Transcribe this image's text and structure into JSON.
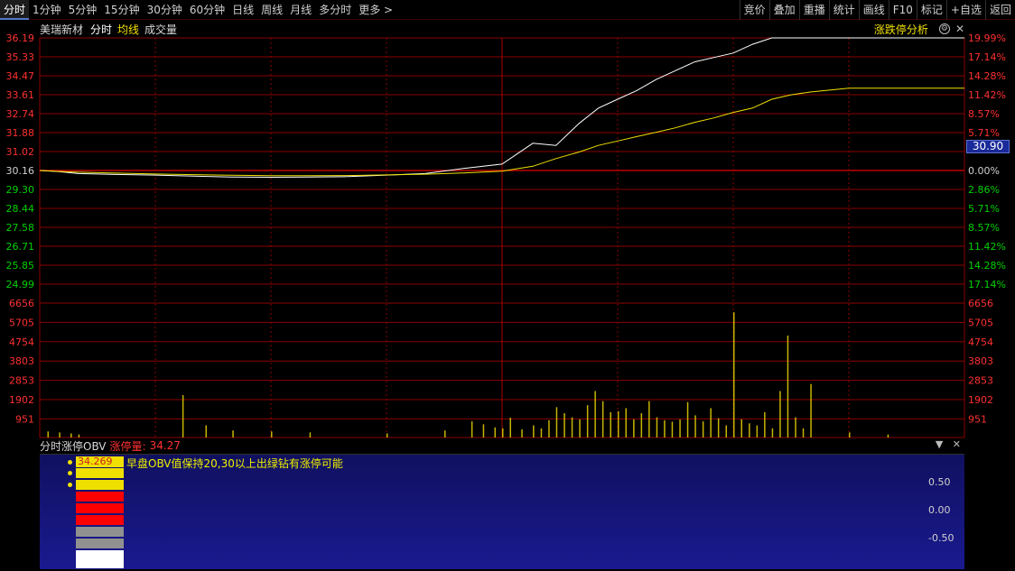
{
  "toolbar": {
    "left_items": [
      "分时",
      "1分钟",
      "5分钟",
      "15分钟",
      "30分钟",
      "60分钟",
      "日线",
      "周线",
      "月线",
      "多分时",
      "更多"
    ],
    "right_items": [
      "竞价",
      "叠加",
      "重播",
      "统计",
      "画线",
      "F10",
      "标记",
      "+自选",
      "返回"
    ]
  },
  "header": {
    "stock_name": "美瑞新材",
    "mode": "分时",
    "avg_label": "均线",
    "vol_label": "成交量",
    "analysis": "涨跌停分析"
  },
  "price_tag": "30.90",
  "indicator": {
    "name": "分时涨停OBV",
    "label": "涨停量:",
    "value": "34.27",
    "box_value": "34.269",
    "text": "早盘OBV值保持20,30以上出绿钻有涨停可能",
    "y_labels": [
      "0.50",
      "0.00",
      "-0.50"
    ]
  },
  "colors": {
    "grid": "#8b0000",
    "price_line": "#ffffff",
    "avg_line": "#f0e000",
    "volume": "#c8b400",
    "up": "#ff3030",
    "down": "#00d000",
    "diamond": "#40ff40"
  },
  "chart_data": [
    {
      "type": "line",
      "title": "",
      "y_labels_left": [
        "36.19",
        "35.33",
        "34.47",
        "33.61",
        "32.74",
        "31.88",
        "31.02",
        "30.16",
        "29.30",
        "28.44",
        "27.58",
        "26.71",
        "25.85",
        "24.99"
      ],
      "y_labels_right": [
        "19.99%",
        "17.14%",
        "14.28%",
        "11.42%",
        "8.57%",
        "5.71%",
        "",
        "0.00%",
        "2.86%",
        "5.71%",
        "8.57%",
        "11.42%",
        "14.28%",
        "17.14%"
      ],
      "ylim": [
        24.99,
        36.19
      ],
      "reference": 30.16,
      "x": [
        0,
        5,
        10,
        20,
        30,
        40,
        50,
        60,
        70,
        80,
        90,
        100,
        110,
        120,
        128,
        134,
        140,
        145,
        150,
        155,
        160,
        165,
        170,
        175,
        180,
        185,
        190,
        195,
        200,
        210,
        220,
        230,
        240
      ],
      "series": [
        {
          "values": [
            30.16,
            30.11,
            30.02,
            29.98,
            29.95,
            29.9,
            29.86,
            29.85,
            29.86,
            29.88,
            29.95,
            30.02,
            30.25,
            30.45,
            31.4,
            31.3,
            32.3,
            33.0,
            33.4,
            33.8,
            34.3,
            34.7,
            35.1,
            35.3,
            35.5,
            35.9,
            36.19,
            36.19,
            36.19,
            36.19,
            36.19,
            36.19,
            36.19
          ]
        },
        {
          "values": [
            30.16,
            30.12,
            30.08,
            30.04,
            30.0,
            29.97,
            29.94,
            29.92,
            29.92,
            29.93,
            29.96,
            29.99,
            30.05,
            30.13,
            30.35,
            30.7,
            31.0,
            31.3,
            31.5,
            31.7,
            31.9,
            32.1,
            32.35,
            32.55,
            32.8,
            33.0,
            33.4,
            33.6,
            33.73,
            33.9,
            33.9,
            33.9,
            33.9
          ]
        }
      ]
    },
    {
      "type": "bar",
      "title": "",
      "y_labels_left": [
        "6656",
        "5705",
        "4754",
        "3803",
        "2853",
        "1902",
        "951"
      ],
      "y_labels_right": [
        "6656",
        "5705",
        "4754",
        "3803",
        "2853",
        "1902",
        "951"
      ],
      "ylim": [
        0,
        6656
      ],
      "x": [
        2,
        5,
        8,
        10,
        37,
        43,
        50,
        60,
        70,
        90,
        105,
        112,
        115,
        118,
        120,
        122,
        125,
        128,
        130,
        132,
        134,
        136,
        138,
        140,
        142,
        144,
        146,
        148,
        150,
        152,
        154,
        156,
        158,
        160,
        162,
        164,
        166,
        168,
        170,
        172,
        174,
        176,
        178,
        180,
        182,
        184,
        186,
        188,
        190,
        192,
        194,
        196,
        198,
        200,
        210,
        220
      ],
      "values": [
        300,
        250,
        200,
        150,
        2100,
        600,
        350,
        300,
        250,
        200,
        350,
        800,
        650,
        500,
        450,
        980,
        400,
        600,
        450,
        850,
        1500,
        1200,
        1000,
        900,
        1600,
        2300,
        1800,
        1250,
        1300,
        1450,
        900,
        1200,
        1800,
        1000,
        850,
        780,
        900,
        1750,
        1100,
        800,
        1450,
        950,
        600,
        6200,
        900,
        700,
        600,
        1250,
        450,
        2300,
        5050,
        1000,
        450,
        2650,
        250,
        150
      ]
    },
    {
      "type": "bar",
      "title": "",
      "y_labels": [
        "0.50",
        "0.00",
        "-0.50"
      ],
      "blocks": [
        "yellow",
        "yellow",
        "red",
        "red",
        "red",
        "gray",
        "gray",
        "white"
      ]
    }
  ]
}
